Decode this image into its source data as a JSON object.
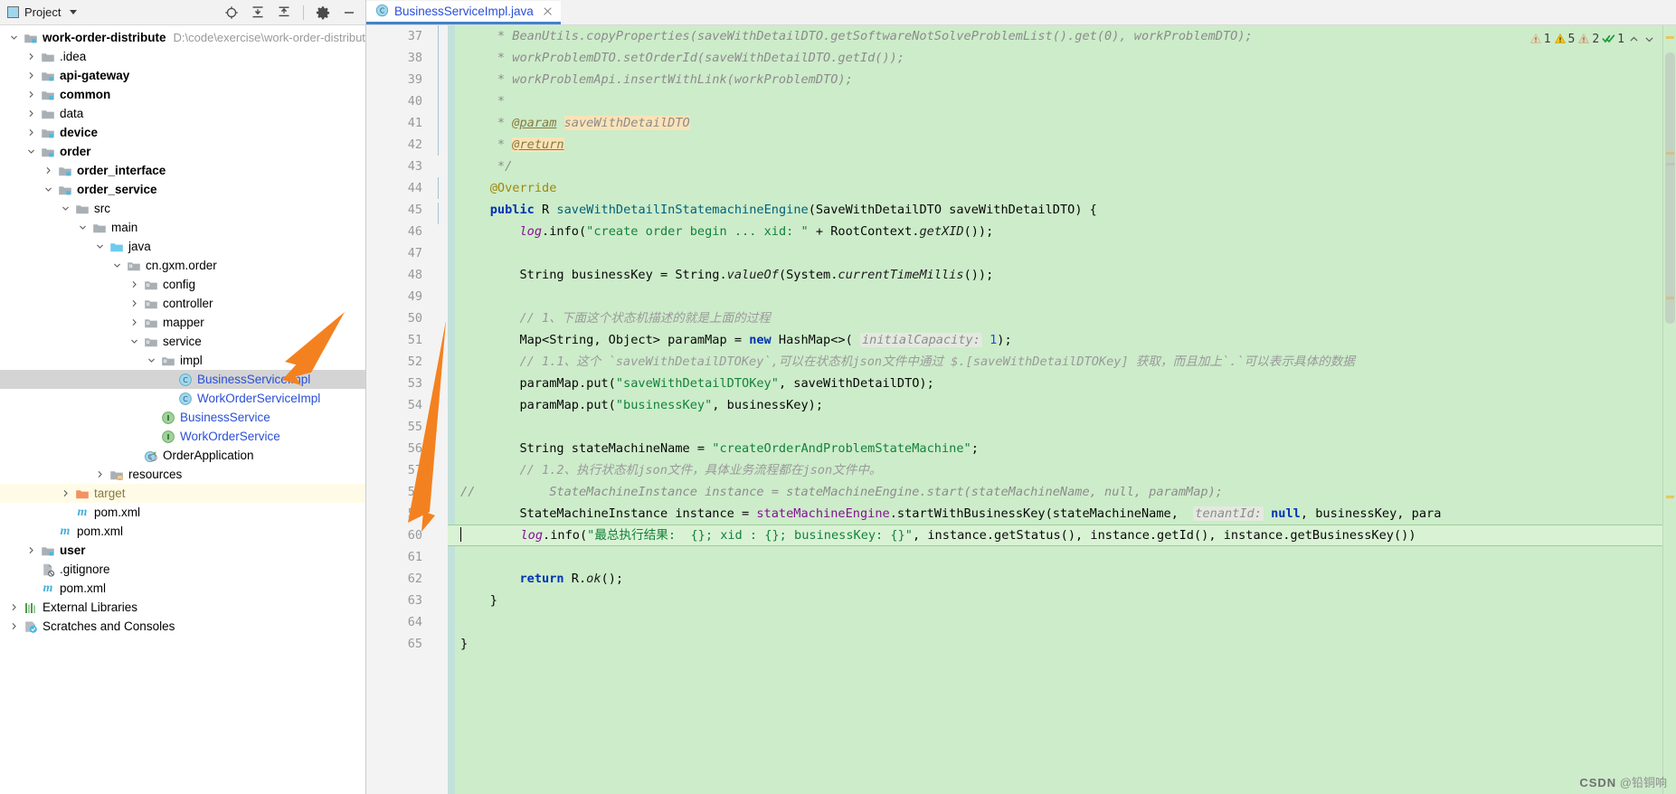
{
  "toolwindow": {
    "title": "Project",
    "icons": [
      "project-icon",
      "dropdown-caret",
      "locate-icon",
      "expand-all-icon",
      "collapse-all-icon",
      "settings-gear-icon",
      "hide-icon"
    ]
  },
  "tree": {
    "items": [
      {
        "depth": 0,
        "label": "work-order-distribute",
        "path": "D:\\code\\exercise\\work-order-distribute",
        "icon": "module-folder",
        "arrow": "down",
        "bold": true
      },
      {
        "depth": 1,
        "label": ".idea",
        "icon": "folder",
        "arrow": "right",
        "bold": false
      },
      {
        "depth": 1,
        "label": "api-gateway",
        "icon": "module-folder",
        "arrow": "right",
        "bold": true
      },
      {
        "depth": 1,
        "label": "common",
        "icon": "module-folder",
        "arrow": "right",
        "bold": true
      },
      {
        "depth": 1,
        "label": "data",
        "icon": "folder",
        "arrow": "right",
        "bold": false
      },
      {
        "depth": 1,
        "label": "device",
        "icon": "module-folder",
        "arrow": "right",
        "bold": true
      },
      {
        "depth": 1,
        "label": "order",
        "icon": "module-folder",
        "arrow": "down",
        "bold": true
      },
      {
        "depth": 2,
        "label": "order_interface",
        "icon": "module-folder",
        "arrow": "right",
        "bold": true
      },
      {
        "depth": 2,
        "label": "order_service",
        "icon": "module-folder",
        "arrow": "down",
        "bold": true
      },
      {
        "depth": 3,
        "label": "src",
        "icon": "folder",
        "arrow": "down",
        "bold": false
      },
      {
        "depth": 4,
        "label": "main",
        "icon": "folder",
        "arrow": "down",
        "bold": false
      },
      {
        "depth": 5,
        "label": "java",
        "icon": "source-folder",
        "arrow": "down",
        "bold": false
      },
      {
        "depth": 6,
        "label": "cn.gxm.order",
        "icon": "package",
        "arrow": "down",
        "bold": false
      },
      {
        "depth": 7,
        "label": "config",
        "icon": "package",
        "arrow": "right",
        "bold": false
      },
      {
        "depth": 7,
        "label": "controller",
        "icon": "package",
        "arrow": "right",
        "bold": false
      },
      {
        "depth": 7,
        "label": "mapper",
        "icon": "package",
        "arrow": "right",
        "bold": false
      },
      {
        "depth": 7,
        "label": "service",
        "icon": "package",
        "arrow": "down",
        "bold": false
      },
      {
        "depth": 8,
        "label": "impl",
        "icon": "package",
        "arrow": "down",
        "bold": false
      },
      {
        "depth": 9,
        "label": "BusinessServiceImpl",
        "icon": "java-class",
        "arrow": "none",
        "selected": true,
        "blue": true
      },
      {
        "depth": 9,
        "label": "WorkOrderServiceImpl",
        "icon": "java-class",
        "arrow": "none",
        "blue": true
      },
      {
        "depth": 8,
        "label": "BusinessService",
        "icon": "java-interface",
        "arrow": "none",
        "blue": true
      },
      {
        "depth": 8,
        "label": "WorkOrderService",
        "icon": "java-interface",
        "arrow": "none",
        "blue": true
      },
      {
        "depth": 7,
        "label": "OrderApplication",
        "icon": "spring-boot-class",
        "arrow": "none",
        "blue": false
      },
      {
        "depth": 5,
        "label": "resources",
        "icon": "resources-folder",
        "arrow": "right",
        "bold": false
      },
      {
        "depth": 3,
        "label": "target",
        "icon": "excluded-folder",
        "arrow": "right",
        "excluded": true,
        "tan": true
      },
      {
        "depth": 3,
        "label": "pom.xml",
        "icon": "maven-file",
        "arrow": "none",
        "bold": false
      },
      {
        "depth": 2,
        "label": "pom.xml",
        "icon": "maven-file",
        "arrow": "none",
        "bold": false
      },
      {
        "depth": 1,
        "label": "user",
        "icon": "module-folder",
        "arrow": "right",
        "bold": true
      },
      {
        "depth": 1,
        "label": ".gitignore",
        "icon": "gitignore-file",
        "arrow": "none",
        "bold": false
      },
      {
        "depth": 1,
        "label": "pom.xml",
        "icon": "maven-file",
        "arrow": "none",
        "bold": false
      },
      {
        "depth": 0,
        "label": "External Libraries",
        "icon": "libraries",
        "arrow": "right",
        "bold": false
      },
      {
        "depth": 0,
        "label": "Scratches and Consoles",
        "icon": "scratches",
        "arrow": "right",
        "bold": false
      }
    ]
  },
  "editor": {
    "tab": {
      "label": "BusinessServiceImpl.java",
      "icon": "java-class",
      "close": "close-icon"
    },
    "inspections": [
      {
        "icon": "warning-triangle-grey",
        "count": "1"
      },
      {
        "icon": "warning-triangle-yellow",
        "count": "5"
      },
      {
        "icon": "warning-triangle-grey",
        "count": "2"
      },
      {
        "icon": "inspection-ok-check",
        "count": "1"
      }
    ],
    "nav": [
      "chevron-up-icon",
      "chevron-down-icon"
    ],
    "first_line_number": 37,
    "caret_line": 60,
    "lines": [
      {
        "n": 37,
        "segs": [
          {
            "t": "     * BeanUtils.copyProperties(saveWithDetailDTO.getSoftwareNotSolveProblemList().get(0), workProblemDTO);",
            "c": "doc"
          }
        ]
      },
      {
        "n": 38,
        "segs": [
          {
            "t": "     * workProblemDTO.setOrderId(saveWithDetailDTO.getId());",
            "c": "doc"
          }
        ]
      },
      {
        "n": 39,
        "segs": [
          {
            "t": "     * workProblemApi.insertWithLink(workProblemDTO);",
            "c": "doc"
          }
        ]
      },
      {
        "n": 40,
        "segs": [
          {
            "t": "     *",
            "c": "doc"
          }
        ]
      },
      {
        "n": 41,
        "segs": [
          {
            "t": "     * ",
            "c": "doc"
          },
          {
            "t": "@param",
            "c": "tag"
          },
          {
            "t": " ",
            "c": "doc"
          },
          {
            "t": "saveWithDetailDTO",
            "c": "doc hl"
          }
        ]
      },
      {
        "n": 42,
        "segs": [
          {
            "t": "     * ",
            "c": "doc"
          },
          {
            "t": "@return",
            "c": "tag hl"
          }
        ]
      },
      {
        "n": 43,
        "segs": [
          {
            "t": "     */",
            "c": "doc"
          }
        ]
      },
      {
        "n": 44,
        "segs": [
          {
            "t": "    @Override",
            "c": "anno"
          }
        ]
      },
      {
        "n": 45,
        "segs": [
          {
            "t": "    ",
            "c": "pln"
          },
          {
            "t": "public",
            "c": "k"
          },
          {
            "t": " R ",
            "c": "pln"
          },
          {
            "t": "saveWithDetailInStatemachineEngine",
            "c": "mth"
          },
          {
            "t": "(SaveWithDetailDTO saveWithDetailDTO) {",
            "c": "pln"
          }
        ],
        "gutterIcon": "implements-interface-icon"
      },
      {
        "n": 46,
        "segs": [
          {
            "t": "        ",
            "c": "pln"
          },
          {
            "t": "log",
            "c": "fld stat"
          },
          {
            "t": ".info(",
            "c": "pln"
          },
          {
            "t": "\"create order begin ... xid: \"",
            "c": "str"
          },
          {
            "t": " + RootContext.",
            "c": "pln"
          },
          {
            "t": "getXID",
            "c": "stat"
          },
          {
            "t": "());",
            "c": "pln"
          }
        ]
      },
      {
        "n": 47,
        "segs": [
          {
            "t": "",
            "c": "pln"
          }
        ]
      },
      {
        "n": 48,
        "segs": [
          {
            "t": "        String businessKey = String.",
            "c": "pln"
          },
          {
            "t": "valueOf",
            "c": "stat"
          },
          {
            "t": "(System.",
            "c": "pln"
          },
          {
            "t": "currentTimeMillis",
            "c": "stat"
          },
          {
            "t": "());",
            "c": "pln"
          }
        ]
      },
      {
        "n": 49,
        "segs": [
          {
            "t": "",
            "c": "pln"
          }
        ]
      },
      {
        "n": 50,
        "segs": [
          {
            "t": "        // 1、下面这个状态机描述的就是上面的过程",
            "c": "cmz"
          }
        ]
      },
      {
        "n": 51,
        "segs": [
          {
            "t": "        Map<String, Object> paramMap = ",
            "c": "pln"
          },
          {
            "t": "new",
            "c": "k"
          },
          {
            "t": " HashMap<>( ",
            "c": "pln"
          },
          {
            "t": "initialCapacity:",
            "c": "hint"
          },
          {
            "t": " ",
            "c": "pln"
          },
          {
            "t": "1",
            "c": "num"
          },
          {
            "t": ");",
            "c": "pln"
          }
        ]
      },
      {
        "n": 52,
        "segs": [
          {
            "t": "        // 1.1、这个 `saveWithDetailDTOKey`,可以在状态机json文件中通过 $.[saveWithDetailDTOKey] 获取，而且加上`.`可以表示具体的数据",
            "c": "cmz"
          }
        ]
      },
      {
        "n": 53,
        "segs": [
          {
            "t": "        paramMap.put(",
            "c": "pln"
          },
          {
            "t": "\"saveWithDetailDTOKey\"",
            "c": "str"
          },
          {
            "t": ", saveWithDetailDTO);",
            "c": "pln"
          }
        ]
      },
      {
        "n": 54,
        "segs": [
          {
            "t": "        paramMap.put(",
            "c": "pln"
          },
          {
            "t": "\"businessKey\"",
            "c": "str"
          },
          {
            "t": ", businessKey);",
            "c": "pln"
          }
        ]
      },
      {
        "n": 55,
        "segs": [
          {
            "t": "",
            "c": "pln"
          }
        ]
      },
      {
        "n": 56,
        "segs": [
          {
            "t": "        String stateMachineName = ",
            "c": "pln"
          },
          {
            "t": "\"createOrderAndProblemStateMachine\"",
            "c": "str"
          },
          {
            "t": ";",
            "c": "pln"
          }
        ]
      },
      {
        "n": 57,
        "segs": [
          {
            "t": "        // 1.2、执行状态机json文件，具体业务流程都在json文件中。",
            "c": "cmz"
          }
        ]
      },
      {
        "n": 58,
        "segs": [
          {
            "t": "//",
            "c": "cm"
          },
          {
            "t": "          StateMachineInstance instance = stateMachineEngine.start(stateMachineName, null, paramMap);",
            "c": "cm"
          }
        ],
        "commentAtGutter": true
      },
      {
        "n": 59,
        "segs": [
          {
            "t": "        StateMachineInstance instance = ",
            "c": "pln"
          },
          {
            "t": "stateMachineEngine",
            "c": "fld"
          },
          {
            "t": ".startWithBusinessKey(stateMachineName,  ",
            "c": "pln"
          },
          {
            "t": "tenantId:",
            "c": "hint"
          },
          {
            "t": " ",
            "c": "pln"
          },
          {
            "t": "null",
            "c": "k"
          },
          {
            "t": ", businessKey, para",
            "c": "pln"
          }
        ]
      },
      {
        "n": 60,
        "segs": [
          {
            "t": "        ",
            "c": "pln"
          },
          {
            "t": "log",
            "c": "fld stat"
          },
          {
            "t": ".info(",
            "c": "pln"
          },
          {
            "t": "\"最总执行结果:  {}; xid : {}; businessKey: {}\"",
            "c": "str"
          },
          {
            "t": ", instance.getStatus(), instance.getId(), instance.getBusinessKey())",
            "c": "pln"
          }
        ],
        "gutterIcon": "bookmark-icon",
        "caret": true
      },
      {
        "n": 61,
        "segs": [
          {
            "t": "",
            "c": "pln"
          }
        ]
      },
      {
        "n": 62,
        "segs": [
          {
            "t": "        ",
            "c": "pln"
          },
          {
            "t": "return",
            "c": "k"
          },
          {
            "t": " R.",
            "c": "pln"
          },
          {
            "t": "ok",
            "c": "stat"
          },
          {
            "t": "();",
            "c": "pln"
          }
        ]
      },
      {
        "n": 63,
        "segs": [
          {
            "t": "    }",
            "c": "pln"
          }
        ]
      },
      {
        "n": 64,
        "segs": [
          {
            "t": "",
            "c": "pln"
          }
        ]
      },
      {
        "n": 65,
        "segs": [
          {
            "t": "}",
            "c": "pln"
          }
        ]
      }
    ]
  },
  "annotations": {
    "arrow_color": "#f4811f",
    "arrows": [
      "arrow-to-business-service-impl",
      "arrow-to-line-60"
    ]
  },
  "watermark": {
    "brand": "CSDN",
    "text": "@铅铜响"
  },
  "colors": {
    "editor_background": "#cdecca",
    "caret_line": "#d9f2d4",
    "selection": "#d4d4d4",
    "excluded_row": "#fffbe6",
    "tab_underline": "#4083c9",
    "link_blue": "#2a4fd7"
  }
}
